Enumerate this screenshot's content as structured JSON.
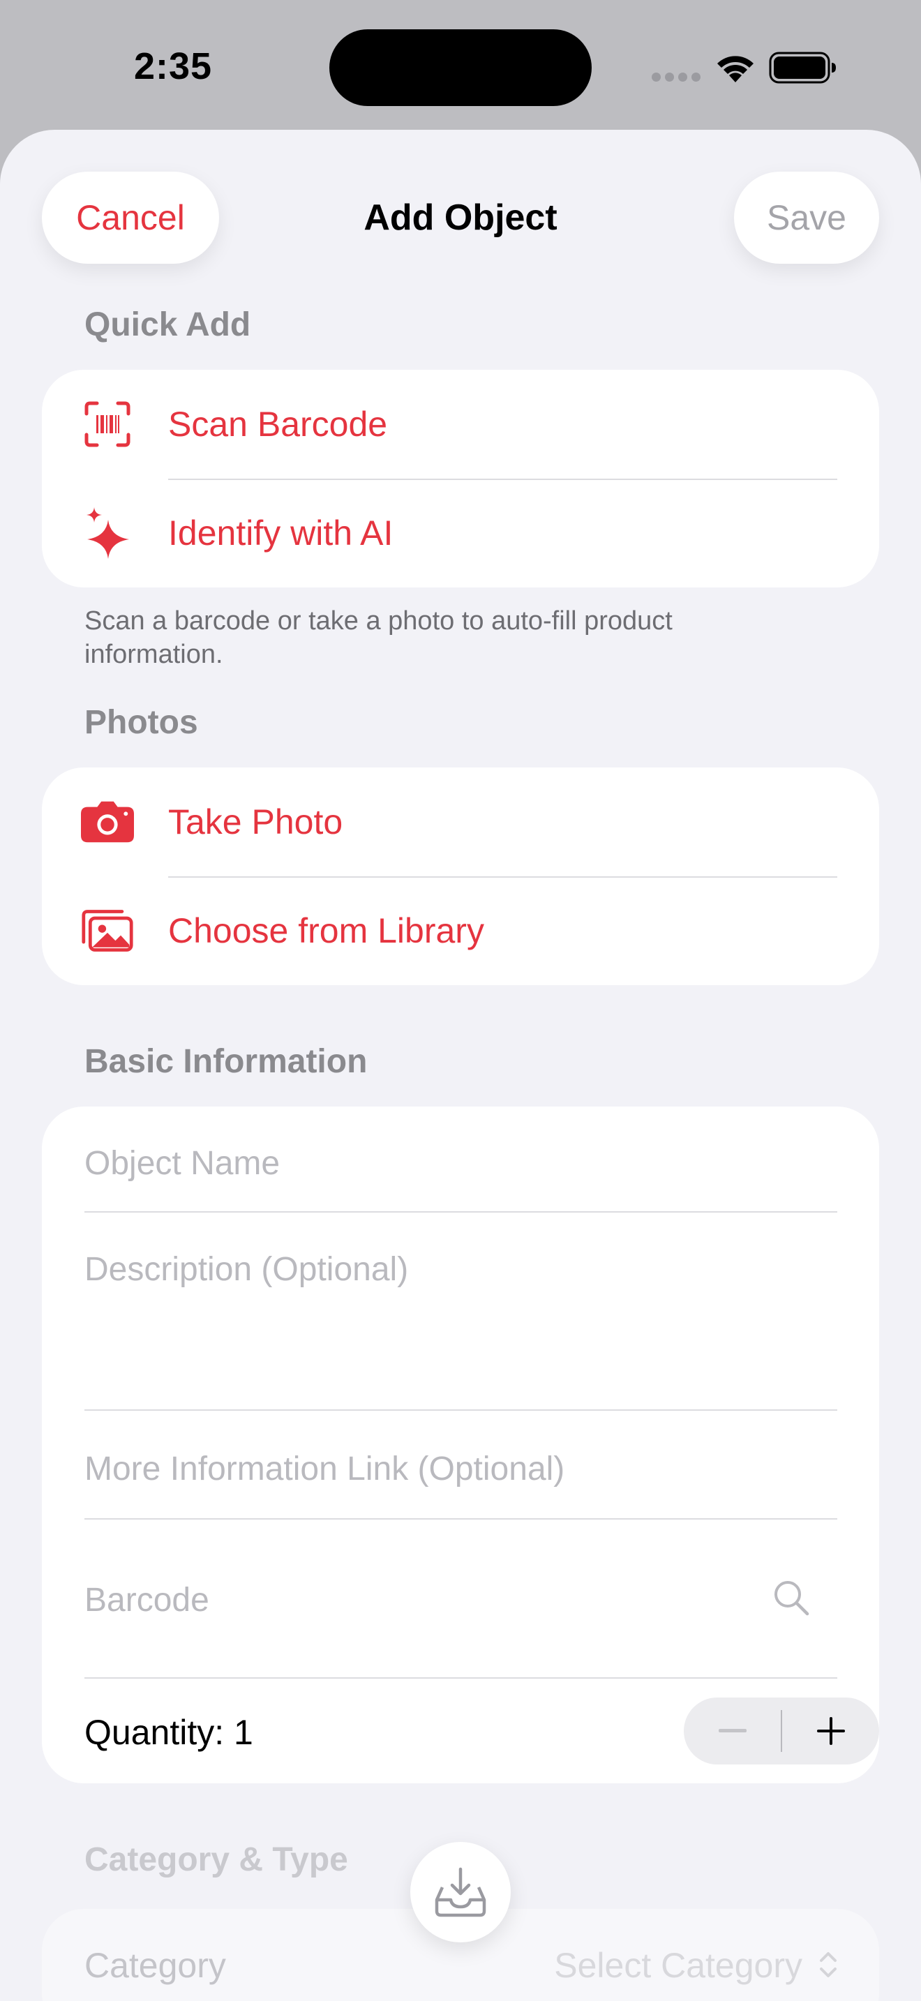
{
  "status": {
    "time": "2:35"
  },
  "nav": {
    "cancel": "Cancel",
    "title": "Add Object",
    "save": "Save"
  },
  "quick_add": {
    "header": "Quick Add",
    "items": [
      {
        "label": "Scan Barcode",
        "icon": "barcode-scan-icon"
      },
      {
        "label": "Identify with AI",
        "icon": "sparkles-icon"
      }
    ],
    "footer": "Scan a barcode or take a photo to auto-fill product information."
  },
  "photos": {
    "header": "Photos",
    "items": [
      {
        "label": "Take Photo",
        "icon": "camera-icon"
      },
      {
        "label": "Choose from Library",
        "icon": "photo-library-icon"
      }
    ]
  },
  "basic_info": {
    "header": "Basic Information",
    "name_placeholder": "Object Name",
    "description_placeholder": "Description (Optional)",
    "link_placeholder": "More Information Link (Optional)",
    "barcode_placeholder": "Barcode",
    "quantity_label": "Quantity: 1",
    "quantity_value": 1
  },
  "category": {
    "header": "Category & Type",
    "label": "Category",
    "value": "Select Category"
  },
  "colors": {
    "accent": "#e5343f",
    "background": "#f2f2f7",
    "placeholder": "#b9b9be"
  }
}
